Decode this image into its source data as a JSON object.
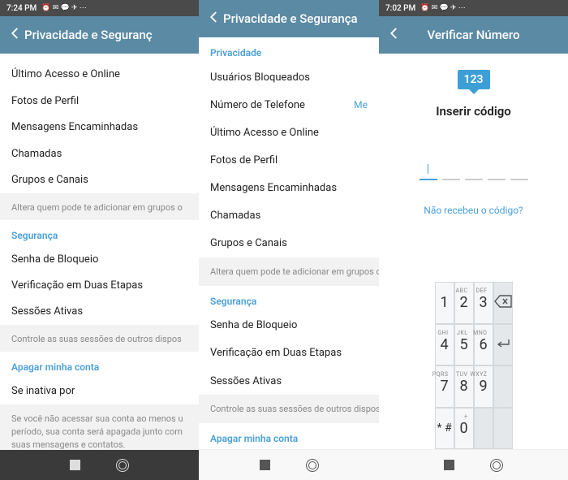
{
  "phone1": {
    "status_time": "7:24 PM",
    "header_title": "Privacidade e Seguranç",
    "items": {
      "last_seen": "Último Acesso e Online",
      "photos": "Fotos de Perfil",
      "forwarded": "Mensagens Encaminhadas",
      "calls": "Chamadas",
      "groups": "Grupos e Canais"
    },
    "groups_hint": "Altera quem pode te adicionar em grupos o",
    "sec_header": "Segurança",
    "sec_items": {
      "passcode": "Senha de Bloqueio",
      "twofac": "Verificação em Duas Etapas",
      "sessions": "Sessões Ativas"
    },
    "sessions_hint": "Controle as suas sessões de outros dispos",
    "delete_header": "Apagar minha conta",
    "delete_item": "Se inativa por",
    "delete_hint": "Se você não acessar sua conta ao menos u período, sua conta será apagada junto com suas mensagens e contatos."
  },
  "phone2": {
    "header_title": "Privacidade e Segurança",
    "priv_header": "Privacidade",
    "items": {
      "blocked": "Usuários Bloqueados",
      "phone": "Número de Telefone",
      "phone_value": "Me",
      "last_seen": "Último Acesso e Online",
      "photos": "Fotos de Perfil",
      "forwarded": "Mensagens Encaminhadas",
      "calls": "Chamadas",
      "groups": "Grupos e Canais"
    },
    "groups_hint": "Altera quem pode te adicionar em grupos o",
    "sec_header": "Segurança",
    "sec_items": {
      "passcode": "Senha de Bloqueio",
      "twofac": "Verificação em Duas Etapas",
      "sessions": "Sessões Ativas"
    },
    "sessions_hint": "Controle as suas sessões de outros dispos",
    "delete_header": "Apagar minha conta"
  },
  "phone3": {
    "status_time": "7:02 PM",
    "header_title": "Verificar Número",
    "bubble": "123",
    "title": "Inserir código",
    "resend": "Não recebeu o código?",
    "keypad": {
      "k1": "1",
      "k2": "2",
      "k2l": "ABC",
      "k3": "3",
      "k3l": "DEF",
      "k4": "4",
      "k4l": "GHI",
      "k5": "5",
      "k5l": "JKL",
      "k6": "6",
      "k6l": "MNO",
      "k7": "7",
      "k7l": "PQRS",
      "k8": "8",
      "k8l": "TUV",
      "k9": "9",
      "k9l": "WXYZ",
      "kstar": "* #",
      "k0": "0",
      "k0l": "+"
    }
  }
}
